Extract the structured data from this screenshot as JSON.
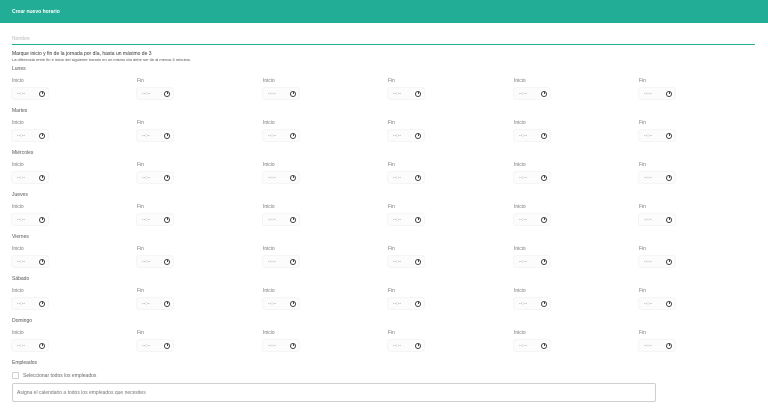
{
  "header": {
    "title": "Crear nuevo horario"
  },
  "form": {
    "name_placeholder": "Nombre",
    "instructions_title": "Marque inicio y fin de la jornada por día, hasta un máximo de 3",
    "instructions_sub": "La diferencia entre fin e inicio del siguiente horario en un mismo día debe ser de al menos 5 minutos.",
    "start_label": "Inicio",
    "end_label": "Fin",
    "time_placeholder": "--:--"
  },
  "days": [
    {
      "label": "Lunes"
    },
    {
      "label": "Martes"
    },
    {
      "label": "Miércoles"
    },
    {
      "label": "Jueves"
    },
    {
      "label": "Viernes"
    },
    {
      "label": "Sábado"
    },
    {
      "label": "Domingo"
    }
  ],
  "employees": {
    "label": "Empleados",
    "select_all_label": "Seleccionar todos los empleados",
    "assign_placeholder": "Asigna el calendario a todos los empleados que necesites"
  },
  "colors": {
    "accent": "#22ad96"
  }
}
